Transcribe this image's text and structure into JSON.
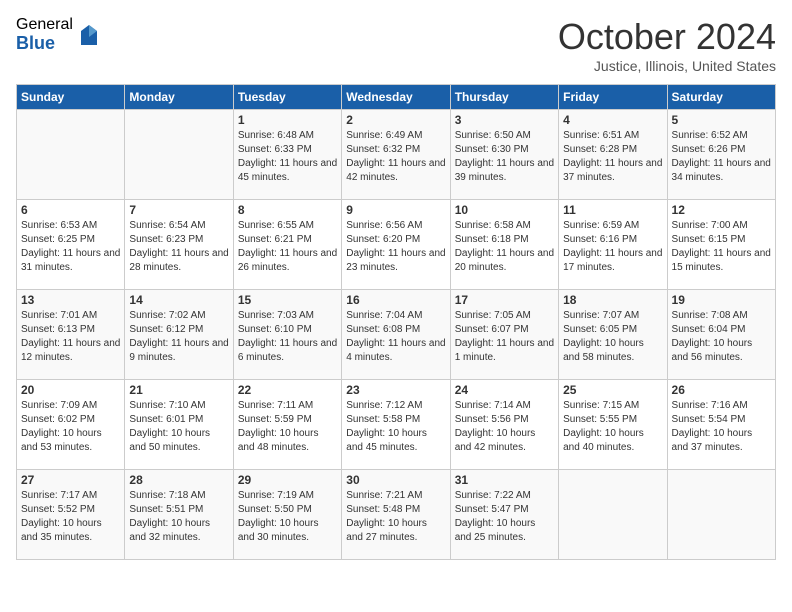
{
  "header": {
    "logo": {
      "general": "General",
      "blue": "Blue"
    },
    "title": "October 2024",
    "location": "Justice, Illinois, United States"
  },
  "days_of_week": [
    "Sunday",
    "Monday",
    "Tuesday",
    "Wednesday",
    "Thursday",
    "Friday",
    "Saturday"
  ],
  "weeks": [
    [
      {
        "day": "",
        "info": ""
      },
      {
        "day": "",
        "info": ""
      },
      {
        "day": "1",
        "info": "Sunrise: 6:48 AM\nSunset: 6:33 PM\nDaylight: 11 hours and 45 minutes."
      },
      {
        "day": "2",
        "info": "Sunrise: 6:49 AM\nSunset: 6:32 PM\nDaylight: 11 hours and 42 minutes."
      },
      {
        "day": "3",
        "info": "Sunrise: 6:50 AM\nSunset: 6:30 PM\nDaylight: 11 hours and 39 minutes."
      },
      {
        "day": "4",
        "info": "Sunrise: 6:51 AM\nSunset: 6:28 PM\nDaylight: 11 hours and 37 minutes."
      },
      {
        "day": "5",
        "info": "Sunrise: 6:52 AM\nSunset: 6:26 PM\nDaylight: 11 hours and 34 minutes."
      }
    ],
    [
      {
        "day": "6",
        "info": "Sunrise: 6:53 AM\nSunset: 6:25 PM\nDaylight: 11 hours and 31 minutes."
      },
      {
        "day": "7",
        "info": "Sunrise: 6:54 AM\nSunset: 6:23 PM\nDaylight: 11 hours and 28 minutes."
      },
      {
        "day": "8",
        "info": "Sunrise: 6:55 AM\nSunset: 6:21 PM\nDaylight: 11 hours and 26 minutes."
      },
      {
        "day": "9",
        "info": "Sunrise: 6:56 AM\nSunset: 6:20 PM\nDaylight: 11 hours and 23 minutes."
      },
      {
        "day": "10",
        "info": "Sunrise: 6:58 AM\nSunset: 6:18 PM\nDaylight: 11 hours and 20 minutes."
      },
      {
        "day": "11",
        "info": "Sunrise: 6:59 AM\nSunset: 6:16 PM\nDaylight: 11 hours and 17 minutes."
      },
      {
        "day": "12",
        "info": "Sunrise: 7:00 AM\nSunset: 6:15 PM\nDaylight: 11 hours and 15 minutes."
      }
    ],
    [
      {
        "day": "13",
        "info": "Sunrise: 7:01 AM\nSunset: 6:13 PM\nDaylight: 11 hours and 12 minutes."
      },
      {
        "day": "14",
        "info": "Sunrise: 7:02 AM\nSunset: 6:12 PM\nDaylight: 11 hours and 9 minutes."
      },
      {
        "day": "15",
        "info": "Sunrise: 7:03 AM\nSunset: 6:10 PM\nDaylight: 11 hours and 6 minutes."
      },
      {
        "day": "16",
        "info": "Sunrise: 7:04 AM\nSunset: 6:08 PM\nDaylight: 11 hours and 4 minutes."
      },
      {
        "day": "17",
        "info": "Sunrise: 7:05 AM\nSunset: 6:07 PM\nDaylight: 11 hours and 1 minute."
      },
      {
        "day": "18",
        "info": "Sunrise: 7:07 AM\nSunset: 6:05 PM\nDaylight: 10 hours and 58 minutes."
      },
      {
        "day": "19",
        "info": "Sunrise: 7:08 AM\nSunset: 6:04 PM\nDaylight: 10 hours and 56 minutes."
      }
    ],
    [
      {
        "day": "20",
        "info": "Sunrise: 7:09 AM\nSunset: 6:02 PM\nDaylight: 10 hours and 53 minutes."
      },
      {
        "day": "21",
        "info": "Sunrise: 7:10 AM\nSunset: 6:01 PM\nDaylight: 10 hours and 50 minutes."
      },
      {
        "day": "22",
        "info": "Sunrise: 7:11 AM\nSunset: 5:59 PM\nDaylight: 10 hours and 48 minutes."
      },
      {
        "day": "23",
        "info": "Sunrise: 7:12 AM\nSunset: 5:58 PM\nDaylight: 10 hours and 45 minutes."
      },
      {
        "day": "24",
        "info": "Sunrise: 7:14 AM\nSunset: 5:56 PM\nDaylight: 10 hours and 42 minutes."
      },
      {
        "day": "25",
        "info": "Sunrise: 7:15 AM\nSunset: 5:55 PM\nDaylight: 10 hours and 40 minutes."
      },
      {
        "day": "26",
        "info": "Sunrise: 7:16 AM\nSunset: 5:54 PM\nDaylight: 10 hours and 37 minutes."
      }
    ],
    [
      {
        "day": "27",
        "info": "Sunrise: 7:17 AM\nSunset: 5:52 PM\nDaylight: 10 hours and 35 minutes."
      },
      {
        "day": "28",
        "info": "Sunrise: 7:18 AM\nSunset: 5:51 PM\nDaylight: 10 hours and 32 minutes."
      },
      {
        "day": "29",
        "info": "Sunrise: 7:19 AM\nSunset: 5:50 PM\nDaylight: 10 hours and 30 minutes."
      },
      {
        "day": "30",
        "info": "Sunrise: 7:21 AM\nSunset: 5:48 PM\nDaylight: 10 hours and 27 minutes."
      },
      {
        "day": "31",
        "info": "Sunrise: 7:22 AM\nSunset: 5:47 PM\nDaylight: 10 hours and 25 minutes."
      },
      {
        "day": "",
        "info": ""
      },
      {
        "day": "",
        "info": ""
      }
    ]
  ]
}
